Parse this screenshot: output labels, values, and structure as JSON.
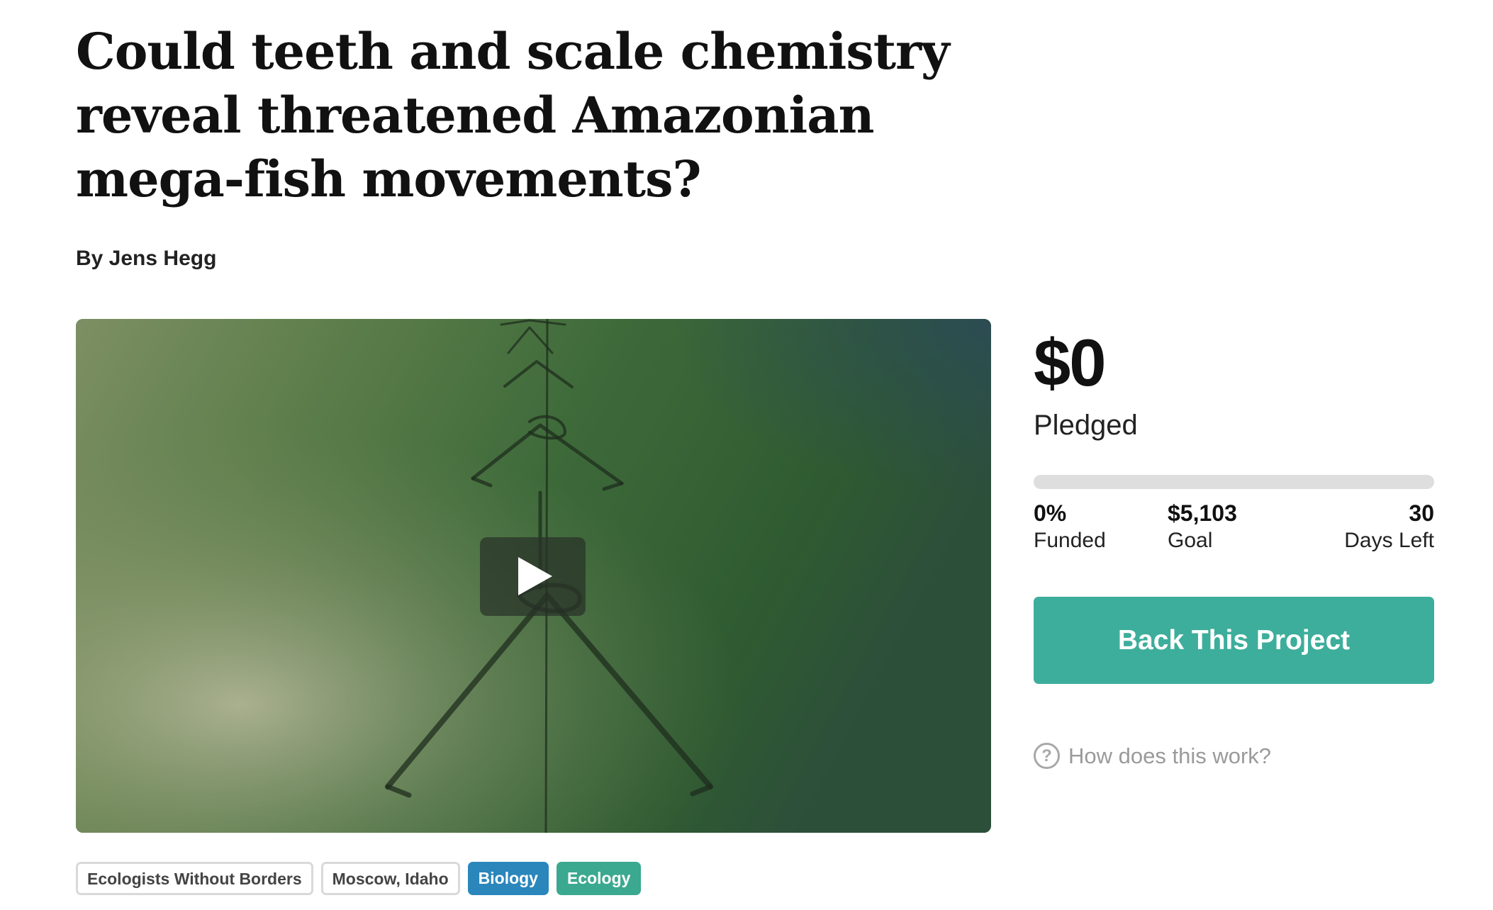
{
  "project": {
    "title": "Could teeth and scale chemistry reveal threatened Amazonian mega-fish movements?",
    "byline": "By Jens Hegg"
  },
  "media": {
    "play_icon": "play-icon"
  },
  "tags": [
    {
      "label": "Ecologists Without Borders",
      "style": "outline"
    },
    {
      "label": "Moscow, Idaho",
      "style": "outline"
    },
    {
      "label": "Biology",
      "style": "blue",
      "color": "#2a86bb"
    },
    {
      "label": "Ecology",
      "style": "green",
      "color": "#3aa98f"
    }
  ],
  "funding": {
    "amount": "$0",
    "amount_label": "Pledged",
    "progress_fraction": 0,
    "funded_value": "0%",
    "funded_label": "Funded",
    "goal_value": "$5,103",
    "goal_label": "Goal",
    "days_value": "30",
    "days_label": "Days Left",
    "back_button": "Back This Project",
    "help_link": "How does this work?",
    "help_icon": "question-circle-icon",
    "accent_color": "#3dae9b"
  }
}
